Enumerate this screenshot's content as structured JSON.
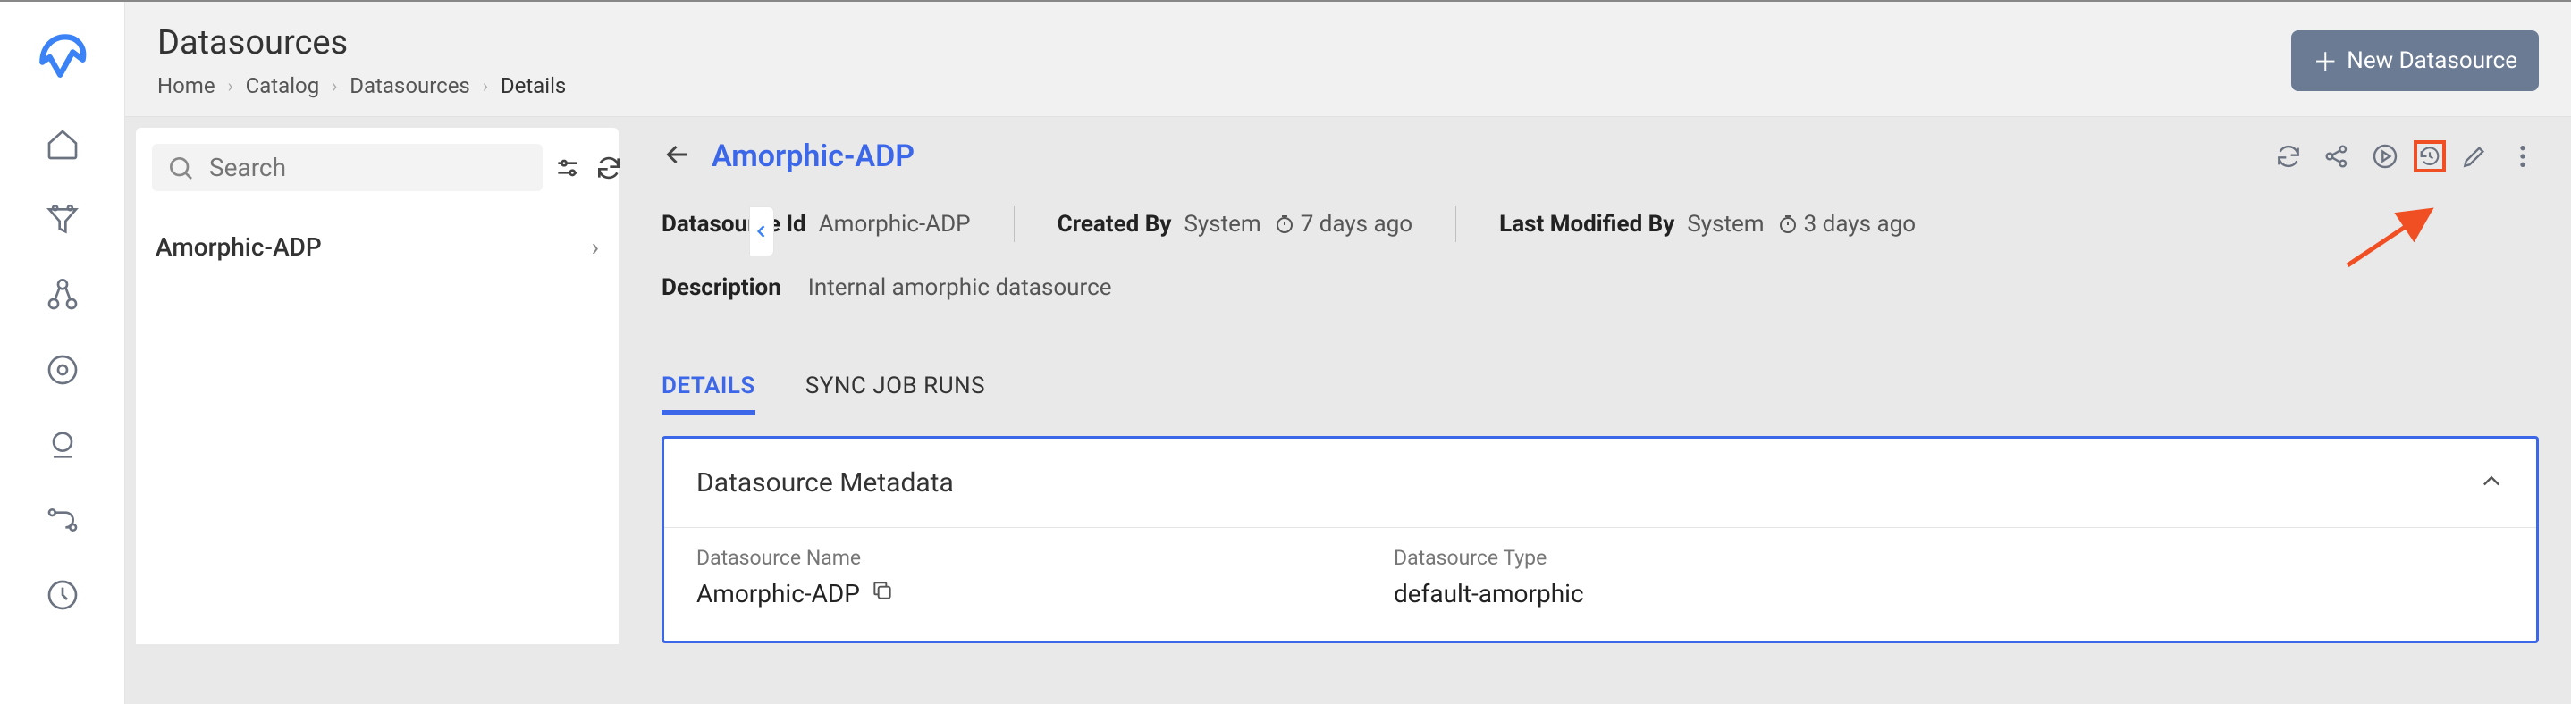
{
  "header": {
    "page_title": "Datasources",
    "breadcrumb": [
      "Home",
      "Catalog",
      "Datasources",
      "Details"
    ],
    "new_button_label": "New Datasource"
  },
  "search": {
    "placeholder": "Search"
  },
  "list": {
    "items": [
      {
        "label": "Amorphic-ADP"
      }
    ]
  },
  "detail": {
    "title": "Amorphic-ADP",
    "meta": {
      "datasource_id_label": "Datasource Id",
      "datasource_id_value": "Amorphic-ADP",
      "created_by_label": "Created By",
      "created_by_value": "System",
      "created_time": "7 days ago",
      "last_modified_by_label": "Last Modified By",
      "last_modified_by_value": "System",
      "last_modified_time": "3 days ago"
    },
    "description_label": "Description",
    "description_value": "Internal amorphic datasource",
    "tabs": {
      "details": "DETAILS",
      "sync_job_runs": "SYNC JOB RUNS"
    },
    "metadata_card": {
      "title": "Datasource Metadata",
      "fields": {
        "name_label": "Datasource Name",
        "name_value": "Amorphic-ADP",
        "type_label": "Datasource Type",
        "type_value": "default-amorphic"
      }
    },
    "toolbar_icons": [
      "refresh",
      "share",
      "play",
      "history",
      "edit",
      "more"
    ]
  }
}
